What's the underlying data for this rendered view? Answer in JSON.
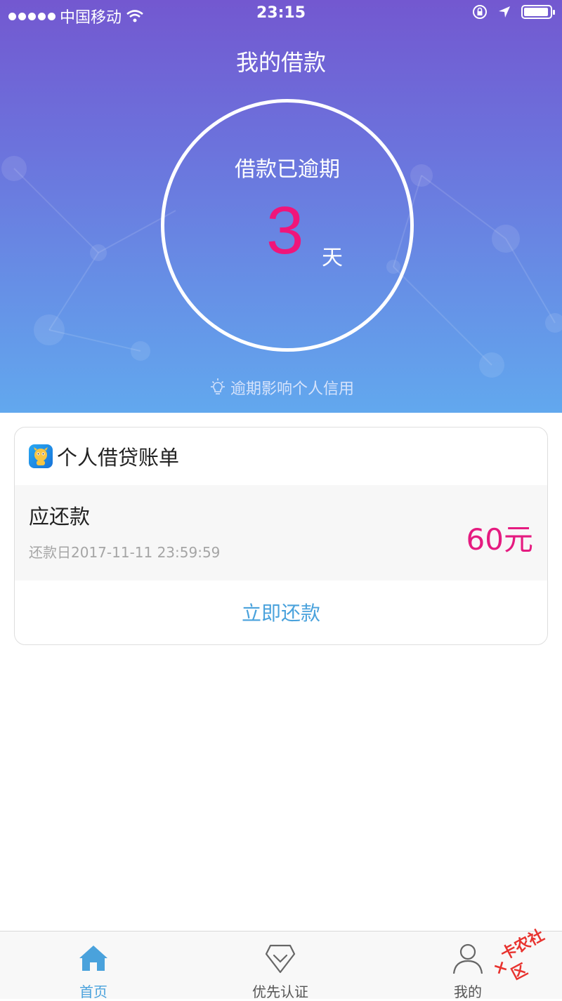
{
  "status_bar": {
    "carrier": "中国移动",
    "time": "23:15"
  },
  "header": {
    "title": "我的借款"
  },
  "overdue": {
    "label": "借款已逾期",
    "days": "3",
    "unit": "天",
    "tip": "逾期影响个人信用"
  },
  "bill_card": {
    "title": "个人借贷账单",
    "due_label": "应还款",
    "due_date": "还款日2017-11-11 23:59:59",
    "amount": "60元",
    "repay_button": "立即还款"
  },
  "tabbar": {
    "items": [
      {
        "label": "首页",
        "icon": "home-icon",
        "active": true
      },
      {
        "label": "优先认证",
        "icon": "certify-icon",
        "active": false
      },
      {
        "label": "我的",
        "icon": "profile-icon",
        "active": false
      }
    ]
  },
  "watermark": {
    "text": "卡农社区"
  },
  "colors": {
    "accent": "#4aa2dc",
    "overdue_number": "#f0157a",
    "amount": "#e51b80"
  }
}
